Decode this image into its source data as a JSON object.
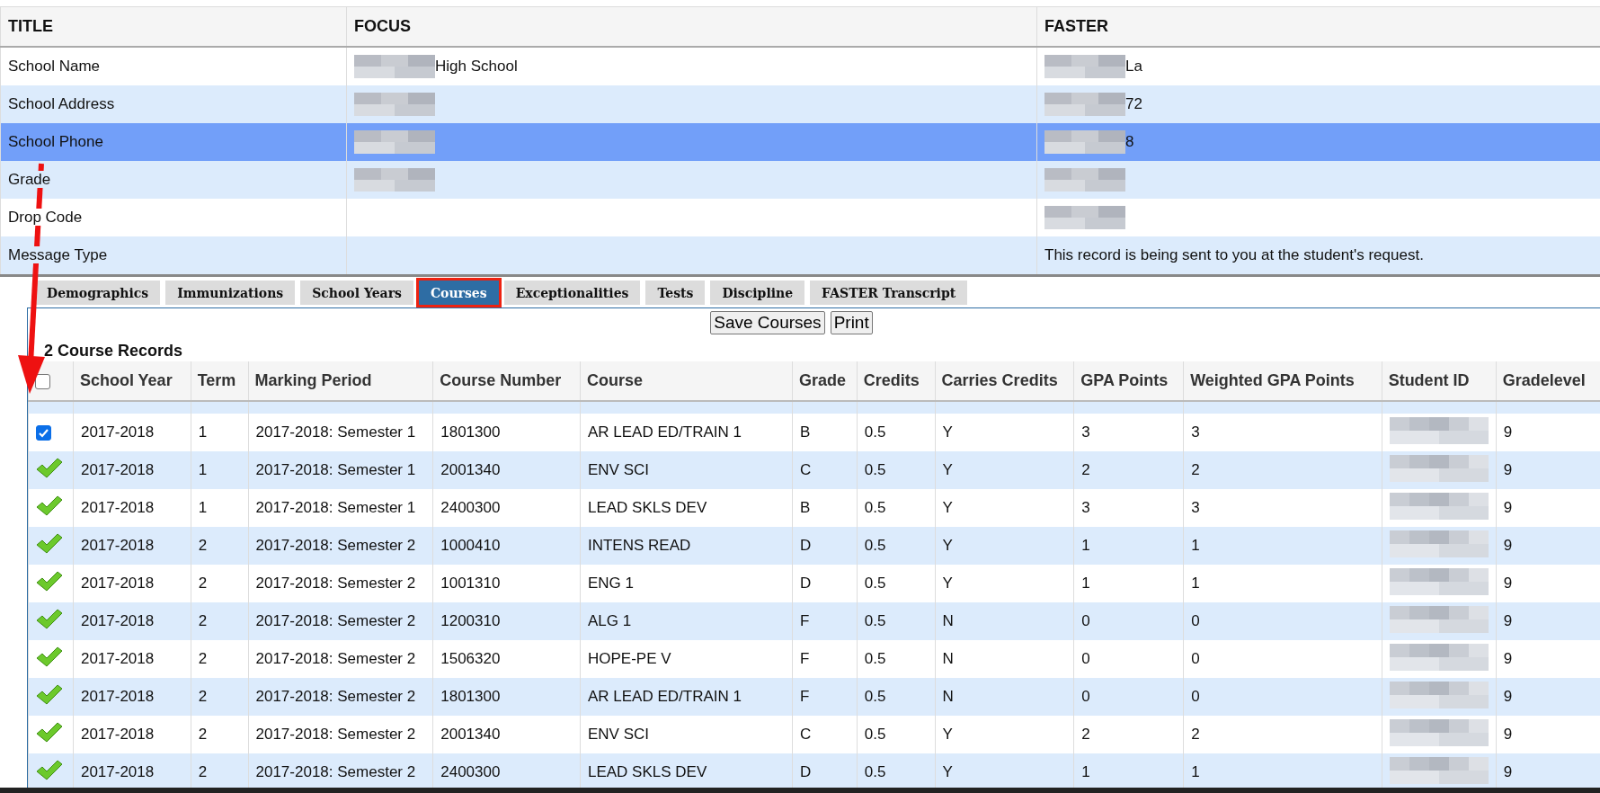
{
  "transfer_table": {
    "columns": [
      "TITLE",
      "FOCUS",
      "FASTER"
    ],
    "rows": [
      {
        "title": "School Name",
        "focus": {
          "text": "High School",
          "redacted": true
        },
        "faster": {
          "text": "La",
          "redacted": true
        },
        "selected": false
      },
      {
        "title": "School Address",
        "focus": {
          "redacted": true
        },
        "faster": {
          "text": "72",
          "redacted": true
        },
        "selected": false
      },
      {
        "title": "School Phone",
        "focus": {
          "redacted": true
        },
        "faster": {
          "text": "8",
          "redacted": true
        },
        "selected": true
      },
      {
        "title": "Grade",
        "focus": {
          "redacted": true
        },
        "faster": {
          "redacted": true
        },
        "selected": false
      },
      {
        "title": "Drop Code",
        "focus": {
          "redacted": false
        },
        "faster": {
          "redacted": true
        },
        "selected": false
      },
      {
        "title": "Message Type",
        "focus": {
          "redacted": false
        },
        "faster": {
          "text": "This record is being sent to you at the student's request.",
          "redacted": false
        },
        "selected": false
      }
    ]
  },
  "tabs": [
    {
      "label": "Demographics",
      "selected": false
    },
    {
      "label": "Immunizations",
      "selected": false
    },
    {
      "label": "School Years",
      "selected": false
    },
    {
      "label": "Courses",
      "selected": true
    },
    {
      "label": "Exceptionalities",
      "selected": false
    },
    {
      "label": "Tests",
      "selected": false
    },
    {
      "label": "Discipline",
      "selected": false
    },
    {
      "label": "FASTER Transcript",
      "selected": false
    }
  ],
  "buttons": [
    "Save Courses",
    "Print"
  ],
  "records_heading": "2 Course Records",
  "courses": {
    "columns": [
      "School Year",
      "Term",
      "Marking Period",
      "Course Number",
      "Course",
      "Grade",
      "Credits",
      "Carries Credits",
      "GPA Points",
      "Weighted GPA Points",
      "Student ID",
      "Gradelevel"
    ],
    "select_all": {
      "checked": false
    },
    "rows": [
      {
        "kind": "checkbox",
        "checked": true,
        "cells": [
          "2017-2018",
          "1",
          "2017-2018: Semester 1",
          "1801300",
          "AR LEAD ED/TRAIN 1",
          "B",
          "0.5",
          "Y",
          "3",
          "3"
        ],
        "gradelevel": "9"
      },
      {
        "kind": "check-mark",
        "cells": [
          "2017-2018",
          "1",
          "2017-2018: Semester 1",
          "2001340",
          "ENV SCI",
          "C",
          "0.5",
          "Y",
          "2",
          "2"
        ],
        "gradelevel": "9"
      },
      {
        "kind": "check-mark",
        "cells": [
          "2017-2018",
          "1",
          "2017-2018: Semester 1",
          "2400300",
          "LEAD SKLS DEV",
          "B",
          "0.5",
          "Y",
          "3",
          "3"
        ],
        "gradelevel": "9"
      },
      {
        "kind": "check-mark",
        "cells": [
          "2017-2018",
          "2",
          "2017-2018: Semester 2",
          "1000410",
          "INTENS READ",
          "D",
          "0.5",
          "Y",
          "1",
          "1"
        ],
        "gradelevel": "9"
      },
      {
        "kind": "check-mark",
        "cells": [
          "2017-2018",
          "2",
          "2017-2018: Semester 2",
          "1001310",
          "ENG 1",
          "D",
          "0.5",
          "Y",
          "1",
          "1"
        ],
        "gradelevel": "9"
      },
      {
        "kind": "check-mark",
        "cells": [
          "2017-2018",
          "2",
          "2017-2018: Semester 2",
          "1200310",
          "ALG 1",
          "F",
          "0.5",
          "N",
          "0",
          "0"
        ],
        "gradelevel": "9"
      },
      {
        "kind": "check-mark",
        "cells": [
          "2017-2018",
          "2",
          "2017-2018: Semester 2",
          "1506320",
          "HOPE-PE V",
          "F",
          "0.5",
          "N",
          "0",
          "0"
        ],
        "gradelevel": "9"
      },
      {
        "kind": "check-mark",
        "cells": [
          "2017-2018",
          "2",
          "2017-2018: Semester 2",
          "1801300",
          "AR LEAD ED/TRAIN 1",
          "F",
          "0.5",
          "N",
          "0",
          "0"
        ],
        "gradelevel": "9"
      },
      {
        "kind": "check-mark",
        "cells": [
          "2017-2018",
          "2",
          "2017-2018: Semester 2",
          "2001340",
          "ENV SCI",
          "C",
          "0.5",
          "Y",
          "2",
          "2"
        ],
        "gradelevel": "9"
      },
      {
        "kind": "check-mark",
        "cells": [
          "2017-2018",
          "2",
          "2017-2018: Semester 2",
          "2400300",
          "LEAD SKLS DEV",
          "D",
          "0.5",
          "Y",
          "1",
          "1"
        ],
        "gradelevel": "9"
      }
    ]
  }
}
